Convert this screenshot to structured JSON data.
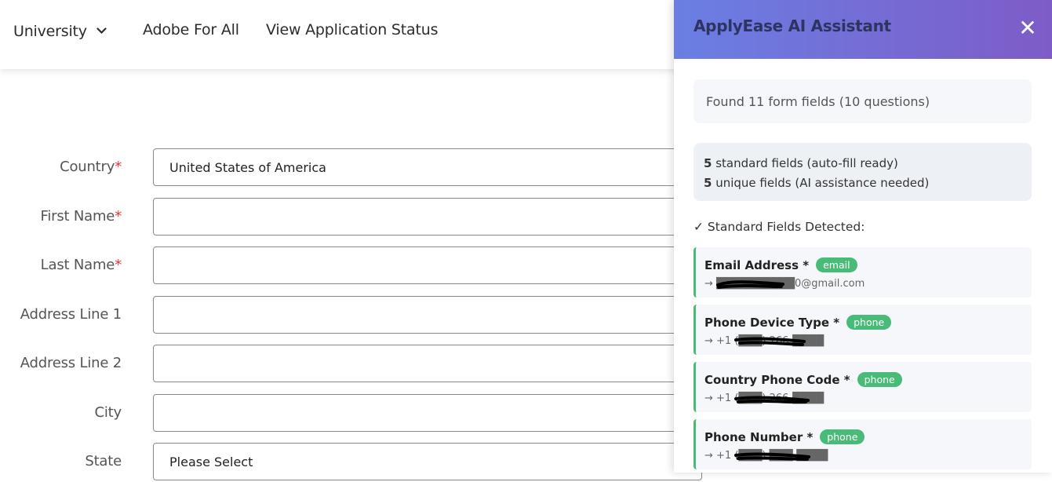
{
  "nav": {
    "university": "University",
    "adobe_for_all": "Adobe For All",
    "view_status": "View Application Status"
  },
  "form": {
    "required_marker": "*",
    "fields": [
      {
        "label": "Country",
        "required": true,
        "value": "United States of America"
      },
      {
        "label": "First Name",
        "required": true,
        "value": ""
      },
      {
        "label": "Last Name",
        "required": true,
        "value": ""
      },
      {
        "label": "Address Line 1",
        "required": false,
        "value": ""
      },
      {
        "label": "Address Line 2",
        "required": false,
        "value": ""
      },
      {
        "label": "City",
        "required": false,
        "value": ""
      },
      {
        "label": "State",
        "required": false,
        "value": "Please Select"
      }
    ]
  },
  "assistant": {
    "title": "ApplyEase AI Assistant",
    "close_glyph": "✕",
    "summary": "Found 11 form fields (10 questions)",
    "standard_count": "5",
    "standard_text": "standard fields (auto-fill ready)",
    "unique_count": "5",
    "unique_text": "unique fields (AI assistance needed)",
    "section_heading": "✓ Standard Fields Detected:",
    "fields": [
      {
        "name": "Email Address *",
        "badge": "email",
        "value": "→ ██████████0@gmail.com"
      },
      {
        "name": "Phone Device Type *",
        "badge": "phone",
        "value": "→ +1 (███) 266-████"
      },
      {
        "name": "Country Phone Code *",
        "badge": "phone",
        "value": "→ +1 (███) 266-████"
      },
      {
        "name": "Phone Number *",
        "badge": "phone",
        "value": "→ +1 (███) ███-████"
      }
    ],
    "badge_color": "#48bb78",
    "header_gradient": [
      "#6a7fe3",
      "#7e5cc7"
    ]
  }
}
